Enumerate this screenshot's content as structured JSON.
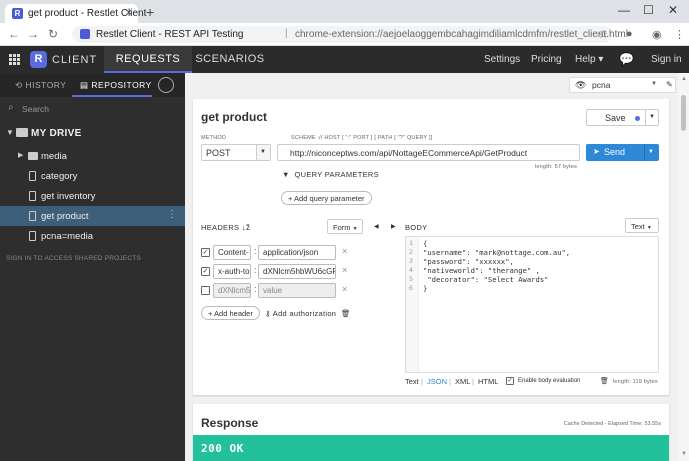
{
  "browser": {
    "tab_title": "get product - Restlet Client",
    "page_title": "Restlet Client - REST API Testing",
    "url": "chrome-extension://aejoelaoggembcahagimdiliamlcdmfm/restlet_client.html"
  },
  "app": {
    "brand": "CLIENT",
    "logo_letter": "R",
    "nav_tabs": [
      "REQUESTS",
      "SCENARIOS"
    ],
    "header_links": [
      "Settings",
      "Pricing",
      "Help",
      "Sign in"
    ],
    "help_caret": "▾"
  },
  "sidebar": {
    "tabs": [
      "HISTORY",
      "REPOSITORY"
    ],
    "search_placeholder": "Search",
    "drive_label": "MY DRIVE",
    "items": [
      {
        "label": "media",
        "type": "folder"
      },
      {
        "label": "category",
        "type": "request"
      },
      {
        "label": "get inventory",
        "type": "request"
      },
      {
        "label": "get product",
        "type": "request",
        "selected": true
      },
      {
        "label": "pcna=media",
        "type": "request"
      }
    ],
    "signin_note": "SIGN IN TO ACCESS SHARED PROJECTS"
  },
  "environment": {
    "selected": "pcna"
  },
  "request": {
    "title": "get product",
    "save_label": "Save",
    "method_label": "METHOD",
    "method": "POST",
    "url_hint": "SCHEME :// HOST [ \":\" PORT ] [ PATH [ \"?\" QUERY ]]",
    "url": "http://niconceptws.com/api/NottageECommerceApi/GetProduct",
    "url_length": "length: 57 bytes",
    "send_label": "Send",
    "query_params_label": "QUERY PARAMETERS",
    "add_query_param": "+ Add query parameter",
    "headers_label": "HEADERS",
    "headers_sort": "↓ž",
    "headers_mode": "Form",
    "headers": [
      {
        "checked": true,
        "name": "Content-",
        "value": "application/json"
      },
      {
        "checked": true,
        "name": "x-auth-to",
        "value": "dXNlcm5hbWU6cGF"
      },
      {
        "checked": false,
        "name": "dXNlcm5",
        "value": "value"
      }
    ],
    "add_header": "+ Add header",
    "add_authorization": "Add authorization",
    "body_label": "BODY",
    "body_mode": "Text",
    "body_lines": [
      "{",
      "\"username\": \"mark@nottage.com.au\",",
      "\"password\": \"xxxxxx\",",
      "\"nativeworld\": \"therange\" ,",
      " \"decorator\": \"Select Awards\"",
      "}"
    ],
    "body_formats": [
      "Text",
      "JSON",
      "XML",
      "HTML"
    ],
    "body_active_format": "JSON",
    "body_eval_label": "Enable body evaluation",
    "body_length": "length: 119 bytes"
  },
  "response": {
    "title": "Response",
    "cache_note": "Cache Detected - Elapsed Time: 53.55s",
    "status": "200 OK"
  },
  "colors": {
    "accent": "#5a6adf",
    "send_button": "#2d88d8",
    "status_ok": "#23c19b",
    "sidebar_selected": "#3e5f7a"
  }
}
